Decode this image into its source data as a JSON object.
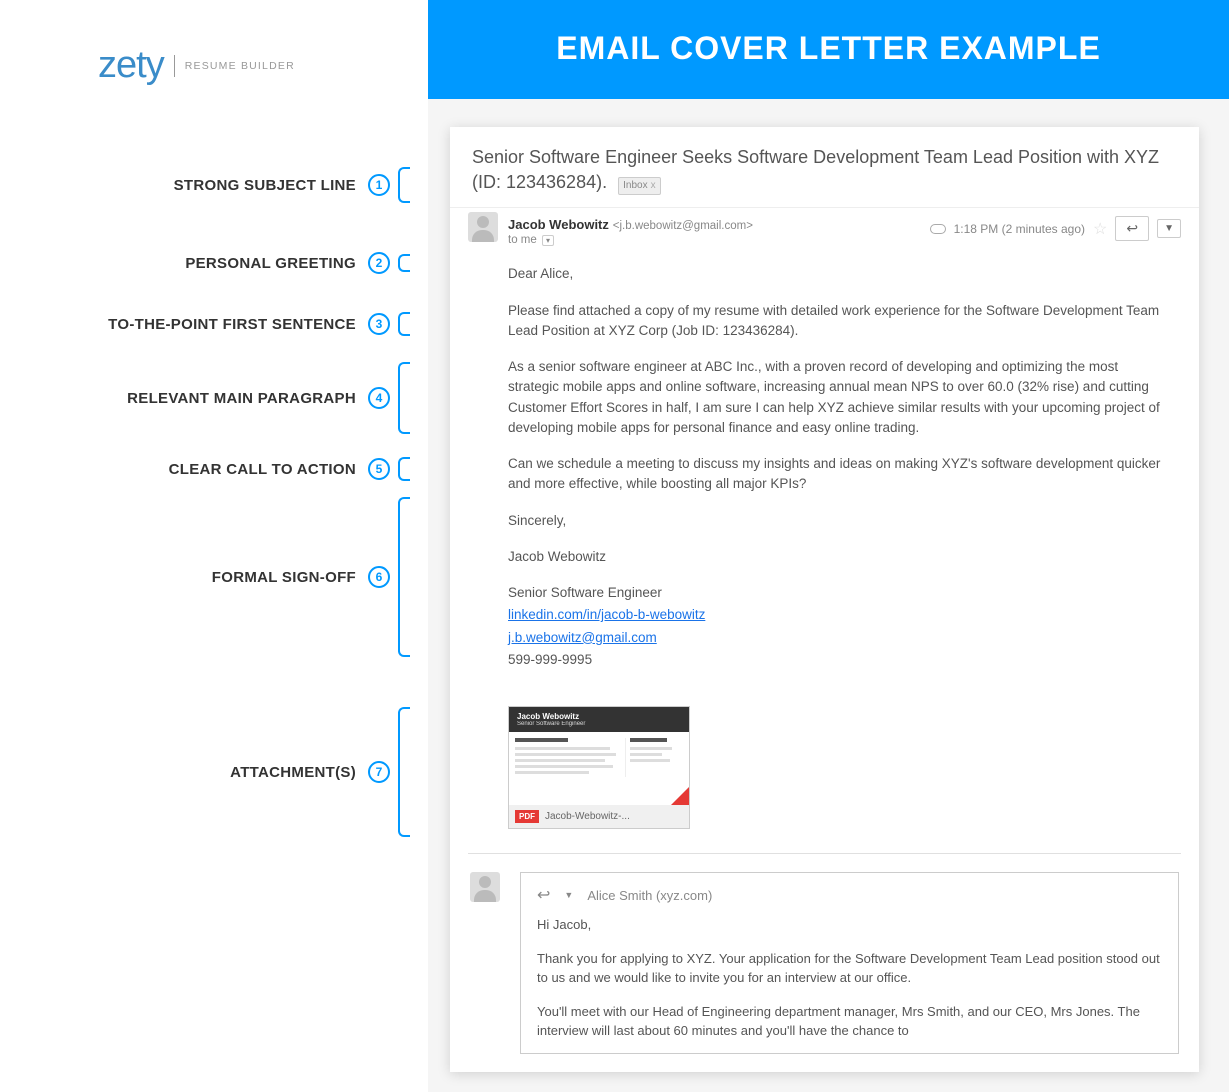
{
  "logo": {
    "brand": "zety",
    "subtitle": "RESUME BUILDER"
  },
  "banner": {
    "title": "EMAIL COVER LETTER EXAMPLE"
  },
  "annotations": [
    {
      "num": "1",
      "label": "STRONG SUBJECT LINE"
    },
    {
      "num": "2",
      "label": "PERSONAL GREETING"
    },
    {
      "num": "3",
      "label": "TO-THE-POINT FIRST SENTENCE"
    },
    {
      "num": "4",
      "label": "RELEVANT MAIN PARAGRAPH"
    },
    {
      "num": "5",
      "label": "CLEAR CALL TO ACTION"
    },
    {
      "num": "6",
      "label": "FORMAL SIGN-OFF"
    },
    {
      "num": "7",
      "label": "ATTACHMENT(S)"
    }
  ],
  "email": {
    "subject": "Senior Software Engineer Seeks Software Development Team Lead Position with XYZ (ID: 123436284).",
    "inbox_tag": "Inbox",
    "inbox_x": "x",
    "sender_name": "Jacob Webowitz",
    "sender_email": "<j.b.webowitz@gmail.com>",
    "to_me": "to me",
    "timestamp": "1:18 PM (2 minutes ago)",
    "greeting": "Dear Alice,",
    "p1": "Please find attached a copy of my resume with detailed work experience for the Software Development Team Lead Position at XYZ Corp (Job ID: 123436284).",
    "p2": "As a senior software engineer at ABC Inc., with a proven record of developing and optimizing the most strategic mobile apps and online software, increasing annual mean NPS to over 60.0 (32% rise) and cutting Customer Effort Scores in half, I am sure I can help XYZ achieve similar results with your upcoming project of developing mobile apps for personal finance and easy online trading.",
    "p3": "Can we schedule a meeting to discuss my insights and ideas on making XYZ's software development quicker and more effective, while boosting all major KPIs?",
    "signoff": "Sincerely,",
    "name": "Jacob Webowitz",
    "title": "Senior Software Engineer",
    "linkedin": "linkedin.com/in/jacob-b-webowitz",
    "email_addr": "j.b.webowitz@gmail.com",
    "phone": "599-999-9995"
  },
  "attachment": {
    "preview_name": "Jacob Webowitz",
    "preview_sub": "Senior Software Engineer",
    "pdf_label": "PDF",
    "filename": "Jacob-Webowitz-..."
  },
  "reply": {
    "to": "Alice Smith (xyz.com)",
    "greeting": "Hi Jacob,",
    "p1": "Thank you for applying to XYZ. Your application for the Software Development Team Lead position stood out to us and we would like to invite you for an interview at our office.",
    "p2": "You'll meet with our Head of Engineering department manager, Mrs Smith, and our CEO, Mrs Jones. The interview will last about 60 minutes and you'll have the chance to"
  }
}
